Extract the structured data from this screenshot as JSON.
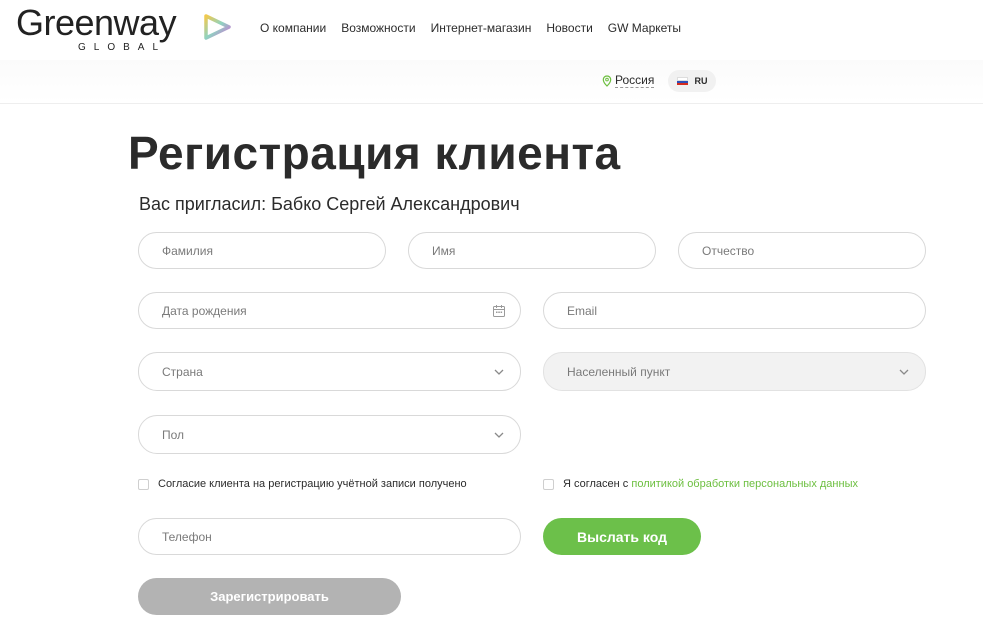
{
  "header": {
    "logo_word": "Greenway",
    "logo_sub": "GLOBAL",
    "nav": [
      {
        "label": "О компании"
      },
      {
        "label": "Возможности"
      },
      {
        "label": "Интернет-магазин"
      },
      {
        "label": "Новости"
      },
      {
        "label": "GW Маркеты"
      }
    ]
  },
  "subbar": {
    "region": "Россия",
    "language": "RU"
  },
  "page": {
    "title": "Регистрация клиента",
    "invited_by": "Вас пригласил: Бабко Сергей Александрович"
  },
  "form": {
    "lastname_placeholder": "Фамилия",
    "firstname_placeholder": "Имя",
    "middlename_placeholder": "Отчество",
    "birthdate_placeholder": "Дата рождения",
    "email_placeholder": "Email",
    "country_placeholder": "Страна",
    "city_placeholder": "Населенный пункт",
    "gender_placeholder": "Пол",
    "consent_label": "Согласие клиента на регистрацию учётной записи получено",
    "agree_prefix": "Я согласен с",
    "agree_link": "политикой обработки персональных данных",
    "phone_placeholder": "Телефон",
    "send_code_label": "Выслать код",
    "register_label": "Зарегистрировать"
  },
  "colors": {
    "accent_green": "#6cc04a",
    "link_green": "#6cbf3f",
    "disabled_button": "#b3b3b3"
  },
  "icons": {
    "logo_mark": "play-triangle-icon",
    "region": "location-pin-icon",
    "flag": "russia-flag-icon",
    "date": "calendar-icon",
    "select": "chevron-down-icon"
  }
}
